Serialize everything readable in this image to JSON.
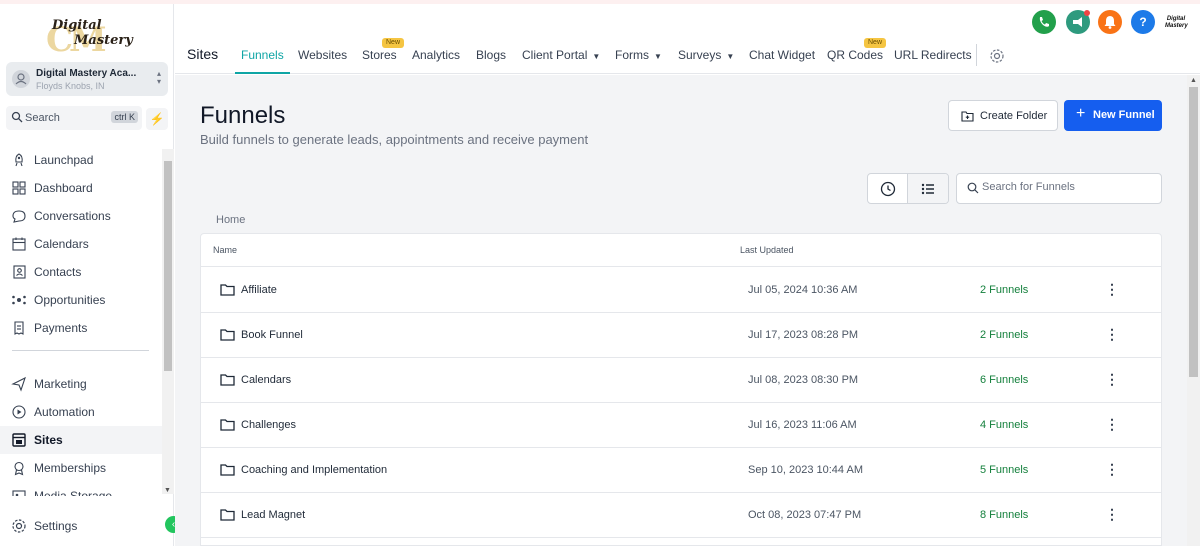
{
  "brand": {
    "logo_line1": "Digital",
    "logo_line2": "Mastery",
    "logo_monogram": "CM"
  },
  "account": {
    "name": "Digital Mastery Aca...",
    "location": "Floyds Knobs, IN"
  },
  "search": {
    "label": "Search",
    "shortcut": "ctrl K"
  },
  "sidebar": {
    "items": [
      {
        "label": "Launchpad",
        "icon": "rocket-icon"
      },
      {
        "label": "Dashboard",
        "icon": "grid-icon"
      },
      {
        "label": "Conversations",
        "icon": "chat-icon"
      },
      {
        "label": "Calendars",
        "icon": "calendar-icon"
      },
      {
        "label": "Contacts",
        "icon": "contact-card-icon"
      },
      {
        "label": "Opportunities",
        "icon": "network-icon"
      },
      {
        "label": "Payments",
        "icon": "receipt-icon"
      },
      {
        "label": "Marketing",
        "icon": "send-icon"
      },
      {
        "label": "Automation",
        "icon": "automation-icon"
      },
      {
        "label": "Sites",
        "icon": "sites-icon",
        "active": true
      },
      {
        "label": "Memberships",
        "icon": "badge-icon"
      },
      {
        "label": "Media Storage",
        "icon": "media-icon"
      }
    ],
    "settings_label": "Settings"
  },
  "header": {
    "section_title": "Sites",
    "tabs": [
      {
        "label": "Funnels",
        "active": true
      },
      {
        "label": "Websites"
      },
      {
        "label": "Stores",
        "badge": "New"
      },
      {
        "label": "Analytics"
      },
      {
        "label": "Blogs"
      },
      {
        "label": "Client Portal",
        "dropdown": true
      },
      {
        "label": "Forms",
        "dropdown": true
      },
      {
        "label": "Surveys",
        "dropdown": true
      },
      {
        "label": "Chat Widget"
      },
      {
        "label": "QR Codes",
        "badge": "New"
      },
      {
        "label": "URL Redirects"
      }
    ],
    "icons": [
      {
        "name": "phone-icon",
        "color": "#22a04b"
      },
      {
        "name": "megaphone-icon",
        "color": "#2e9a7e"
      },
      {
        "name": "bell-icon",
        "color": "#f97316"
      },
      {
        "name": "help-icon",
        "color": "#1d7ae8"
      }
    ],
    "mini_avatar_text": "Digital Mastery"
  },
  "page": {
    "title": "Funnels",
    "subtitle": "Build funnels to generate leads, appointments and receive payment",
    "create_folder_label": "Create Folder",
    "new_funnel_label": "New Funnel",
    "search_placeholder": "Search for Funnels",
    "breadcrumb": "Home"
  },
  "table": {
    "columns": [
      "Name",
      "Last Updated"
    ],
    "rows": [
      {
        "name": "Affiliate",
        "updated": "Jul 05, 2024 10:36 AM",
        "count": "2 Funnels"
      },
      {
        "name": "Book Funnel",
        "updated": "Jul 17, 2023 08:28 PM",
        "count": "2 Funnels"
      },
      {
        "name": "Calendars",
        "updated": "Jul 08, 2023 08:30 PM",
        "count": "6 Funnels"
      },
      {
        "name": "Challenges",
        "updated": "Jul 16, 2023 11:06 AM",
        "count": "4 Funnels"
      },
      {
        "name": "Coaching and Implementation",
        "updated": "Sep 10, 2023 10:44 AM",
        "count": "5 Funnels"
      },
      {
        "name": "Lead Magnet",
        "updated": "Oct 08, 2023 07:47 PM",
        "count": "8 Funnels"
      }
    ]
  },
  "colors": {
    "accent_teal": "#0ea5a5",
    "primary_blue": "#155eef",
    "count_green": "#15803d"
  }
}
